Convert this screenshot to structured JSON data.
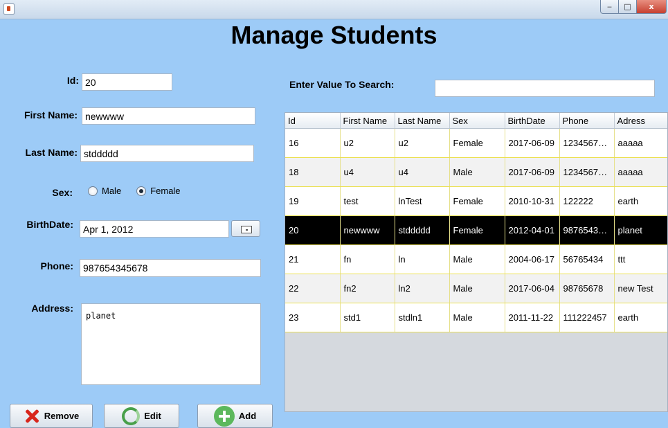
{
  "window": {
    "close_glyph": "x",
    "max_glyph": "□",
    "min_glyph": "‒"
  },
  "title": "Manage Students",
  "form": {
    "id_label": "Id:",
    "id_value": "20",
    "first_name_label": "First Name:",
    "first_name_value": "newwww",
    "last_name_label": "Last Name:",
    "last_name_value": "stddddd",
    "sex_label": "Sex:",
    "sex_options": [
      "Male",
      "Female"
    ],
    "sex_selected": "Female",
    "birthdate_label": "BirthDate:",
    "birthdate_value": "Apr 1, 2012",
    "phone_label": "Phone:",
    "phone_value": "987654345678",
    "address_label": "Address:",
    "address_value": "planet"
  },
  "buttons": {
    "remove": "Remove",
    "edit": "Edit",
    "add": "Add"
  },
  "search": {
    "label": "Enter Value To Search:",
    "value": ""
  },
  "table": {
    "columns": [
      "Id",
      "First Name",
      "Last Name",
      "Sex",
      "BirthDate",
      "Phone",
      "Adress"
    ],
    "rows": [
      [
        "16",
        "u2",
        "u2",
        "Female",
        "2017-06-09",
        "12345678...",
        "aaaaa"
      ],
      [
        "18",
        "u4",
        "u4",
        "Male",
        "2017-06-09",
        "12345678...",
        "aaaaa"
      ],
      [
        "19",
        "test",
        "lnTest",
        "Female",
        "2010-10-31",
        "122222",
        "earth"
      ],
      [
        "20",
        "newwww",
        "stddddd",
        "Female",
        "2012-04-01",
        "98765434...",
        "planet"
      ],
      [
        "21",
        "fn",
        "ln",
        "Male",
        "2004-06-17",
        "56765434",
        "ttt"
      ],
      [
        "22",
        "fn2",
        "ln2",
        "Male",
        "2017-06-04",
        "98765678",
        "new Test"
      ],
      [
        "23",
        "std1",
        "stdln1",
        "Male",
        "2011-11-22",
        "111222457",
        "earth"
      ]
    ],
    "selected_row_id": "20"
  },
  "colors": {
    "background": "#9dcbf7",
    "selection": "#000000",
    "row_border": "#ebe04f"
  },
  "icons": {
    "remove": "x-icon",
    "edit": "refresh-icon",
    "add": "plus-icon",
    "calendar": "calendar-icon"
  }
}
